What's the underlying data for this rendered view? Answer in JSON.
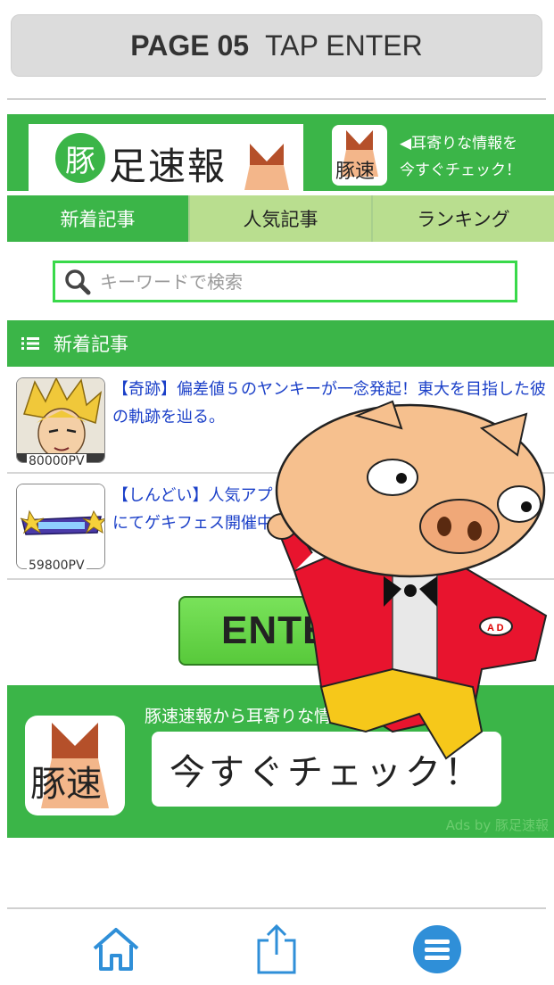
{
  "banner": {
    "page_label": "PAGE 05",
    "instruction": "TAP ENTER"
  },
  "header": {
    "logo_circle_char": "豚",
    "logo_text": "足速報",
    "tagline_line1": "◀耳寄りな情報を",
    "tagline_line2": "今すぐチェック！",
    "icon_text": "豚速"
  },
  "tabs": [
    {
      "label": "新着記事",
      "active": true
    },
    {
      "label": "人気記事",
      "active": false
    },
    {
      "label": "ランキング",
      "active": false
    }
  ],
  "search": {
    "placeholder": "キーワードで検索",
    "icon": "search-icon"
  },
  "section": {
    "title": "新着記事",
    "icon": "list-icon"
  },
  "articles": [
    {
      "title": "【奇跡】偏差値５のヤンキーが一念発起！東大を目指した彼の軌跡を辿る。",
      "pv": "80000PV"
    },
    {
      "title": "【しんどい】人気アプリゲーム…にてゲキフェス開催中！金率…",
      "pv": "59800PV"
    }
  ],
  "enter_button": {
    "label": "ENTER"
  },
  "ad": {
    "tagline": "豚速速報から耳寄りな情報をゲット！",
    "button_label": "今すぐチェック！",
    "icon_text": "豚速",
    "ads_by": "Ads by 豚足速報"
  },
  "bottom_nav": [
    {
      "icon": "home-icon"
    },
    {
      "icon": "share-icon"
    },
    {
      "icon": "menu-icon"
    }
  ],
  "colors": {
    "green": "#3bb548",
    "light_green": "#b9de8f",
    "link_blue": "#1a3fc8",
    "nav_blue": "#2f8fd8"
  }
}
